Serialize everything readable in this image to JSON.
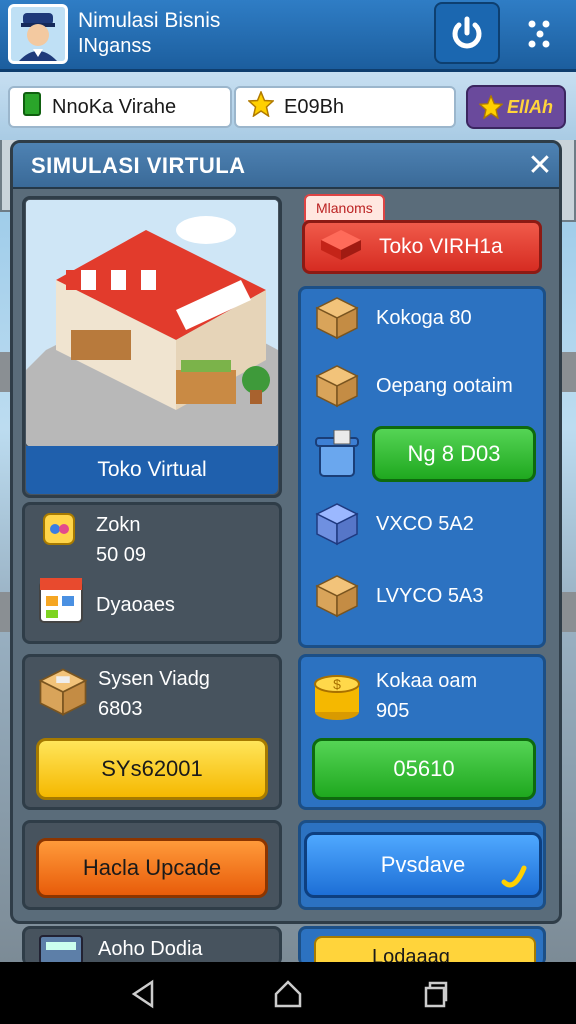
{
  "app": {
    "title": "Nimulasi Bisnis",
    "subtitle": "INganss"
  },
  "stats": {
    "item1_label": "NnoKa Virahe",
    "item2_label": "E09Bh",
    "badge_label": "EllAh"
  },
  "panel": {
    "title": "SIMULASI VIRTULA",
    "close_icon": "close-icon"
  },
  "store": {
    "caption": "Toko Virtual"
  },
  "info_card": {
    "line1": "Zokn",
    "line2": "50 09",
    "line3": "Dyaoaes"
  },
  "right_panel": {
    "tab_label": "Mlanoms",
    "red_button": "Toko VIRH1a",
    "items": [
      {
        "label": "Kokoga 80",
        "icon": "box-icon"
      },
      {
        "label": "Oepang ootaim",
        "icon": "box-icon"
      },
      {
        "label": "VXCO 5A2",
        "icon": "blue-box-icon"
      },
      {
        "label": "LVYCO 5A3",
        "icon": "box-icon"
      }
    ],
    "green_button": "Ng 8 D03"
  },
  "system_card": {
    "line1": "Sysen Viadg",
    "line2": "6803",
    "button": "SYs62001"
  },
  "coins_card": {
    "line1": "Kokaa oam",
    "line2": "905",
    "button": "05610"
  },
  "actions": {
    "upgrade": "Hacla Upcade",
    "save": "Pvsdave"
  },
  "bottom_peek": {
    "left": "Aoho Dodia",
    "right": "Lodaaag"
  },
  "colors": {
    "topbar": "#2f7dc5",
    "panel": "#5a6c7a",
    "blue_card": "#2c72c1",
    "green": "#1fa81f",
    "yellow": "#f5b800",
    "orange": "#e85c0a"
  }
}
